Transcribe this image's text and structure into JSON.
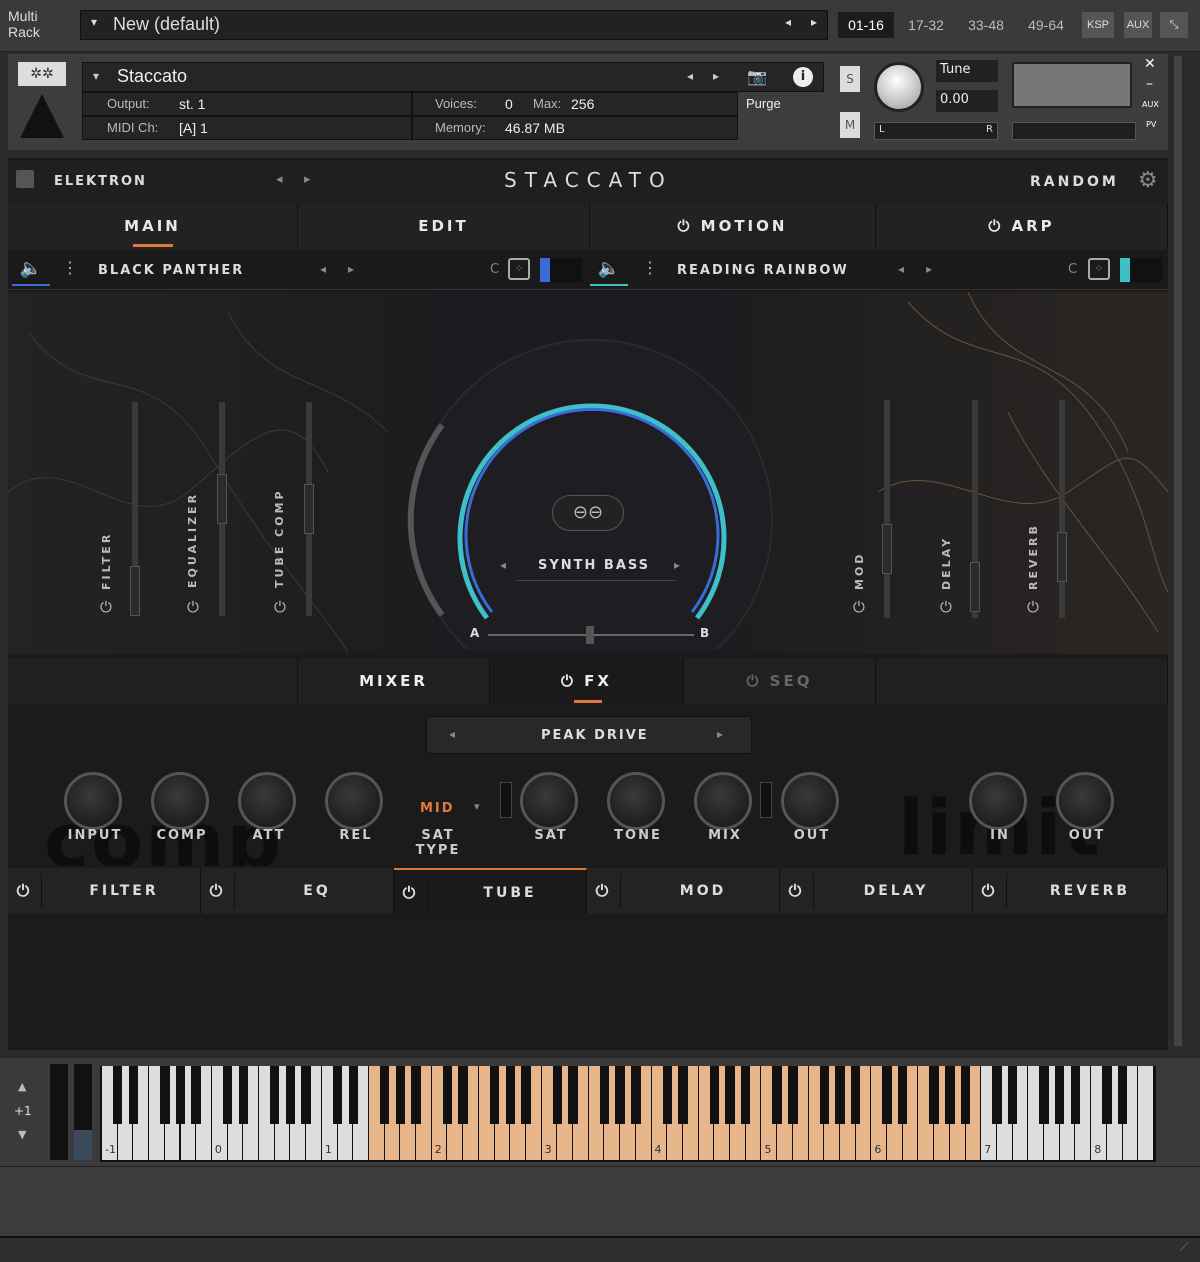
{
  "rack": {
    "title": "Multi Rack",
    "preset": "New (default)",
    "tabs": [
      "01-16",
      "17-32",
      "33-48",
      "49-64"
    ],
    "ksp": "KSP",
    "aux": "AUX"
  },
  "instrument": {
    "name": "Staccato",
    "output_label": "Output:",
    "output_value": "st. 1",
    "midi_label": "MIDI Ch:",
    "midi_value": "[A] 1",
    "voices_label": "Voices:",
    "voices_value": "0",
    "max_label": "Max:",
    "max_value": "256",
    "memory_label": "Memory:",
    "memory_value": "46.87 MB",
    "purge": "Purge",
    "tune_label": "Tune",
    "tune_value": "0.00",
    "s": "S",
    "m": "M",
    "l": "L",
    "r": "R",
    "aux": "AUX",
    "pv": "PV"
  },
  "header": {
    "brand": "ELEKTRON",
    "title": "STACCATO",
    "random": "RANDOM"
  },
  "tabs": [
    "MAIN",
    "EDIT",
    "MOTION",
    "ARP"
  ],
  "layers": [
    {
      "name": "BLACK PANTHER",
      "c": "C"
    },
    {
      "name": "READING RAINBOW",
      "c": "C"
    }
  ],
  "center": {
    "preset": "SYNTH BASS",
    "a": "A",
    "b": "B"
  },
  "sliders_left": [
    "FILTER",
    "EQUALIZER",
    "TUBE COMP"
  ],
  "sliders_right": [
    "MOD",
    "DELAY",
    "REVERB"
  ],
  "subtabs": [
    "MIXER",
    "FX",
    "SEQ"
  ],
  "fx": {
    "preset": "PEAK DRIVE",
    "sat_type_value": "MID",
    "sat_type_label": "SAT TYPE",
    "watermark_left": "comp",
    "watermark_right": "limit",
    "knobs_left": [
      "INPUT",
      "COMP",
      "ATT",
      "REL"
    ],
    "knobs_mid": [
      "SAT",
      "TONE",
      "MIX",
      "OUT"
    ],
    "knobs_right": [
      "IN",
      "OUT"
    ]
  },
  "fxtabs": [
    "FILTER",
    "EQ",
    "TUBE",
    "MOD",
    "DELAY",
    "REVERB"
  ],
  "keyboard": {
    "octave": "+1",
    "octaves": [
      "-1",
      "0",
      "1",
      "2",
      "3",
      "4",
      "5",
      "6",
      "7",
      "8"
    ]
  },
  "colors": {
    "accent": "#e07a3a",
    "blue_ring": "#3a6cd8",
    "teal_ring": "#3fc0c8",
    "key_range": "#e7b58a"
  }
}
